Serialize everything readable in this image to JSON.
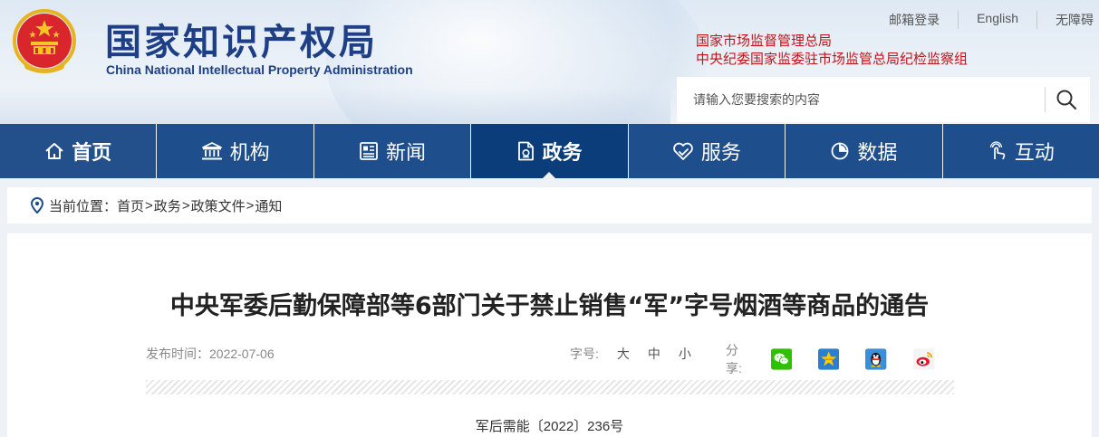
{
  "site": {
    "name_cn": "国家知识产权局",
    "name_en": "China National Intellectual Property Administration"
  },
  "top_links": [
    "邮箱登录",
    "English",
    "无障碍"
  ],
  "affiliates": [
    "国家市场监督管理总局",
    "中央纪委国家监委驻市场监管总局纪检监察组"
  ],
  "search": {
    "placeholder": "请输入您要搜索的内容"
  },
  "nav": [
    {
      "label": "首页",
      "icon": "home-icon"
    },
    {
      "label": "机构",
      "icon": "institution-icon"
    },
    {
      "label": "新闻",
      "icon": "news-icon"
    },
    {
      "label": "政务",
      "icon": "government-affairs-icon",
      "active": true
    },
    {
      "label": "服务",
      "icon": "service-icon"
    },
    {
      "label": "数据",
      "icon": "data-icon"
    },
    {
      "label": "互动",
      "icon": "interaction-icon"
    }
  ],
  "breadcrumb": {
    "prefix": "当前位置：",
    "items": [
      "首页",
      "政务",
      "政策文件",
      "通知"
    ],
    "separator": ">"
  },
  "article": {
    "title": "中央军委后勤保障部等6部门关于禁止销售“军”字号烟酒等商品的通告",
    "date_label": "发布时间：2022-07-06",
    "font_size_label": "字号:",
    "font_sizes": [
      "大",
      "中",
      "小"
    ],
    "share_label": "分享:",
    "share_targets": [
      "wechat-icon",
      "qzone-icon",
      "qq-icon",
      "weibo-icon"
    ],
    "doc_number": "军后需能〔2022〕236号"
  },
  "colors": {
    "nav_bg": "#1e4e8c",
    "nav_active_bg": "#0b3d7a",
    "brand_text": "#1e3f86",
    "affiliate_text": "#c0141b"
  }
}
